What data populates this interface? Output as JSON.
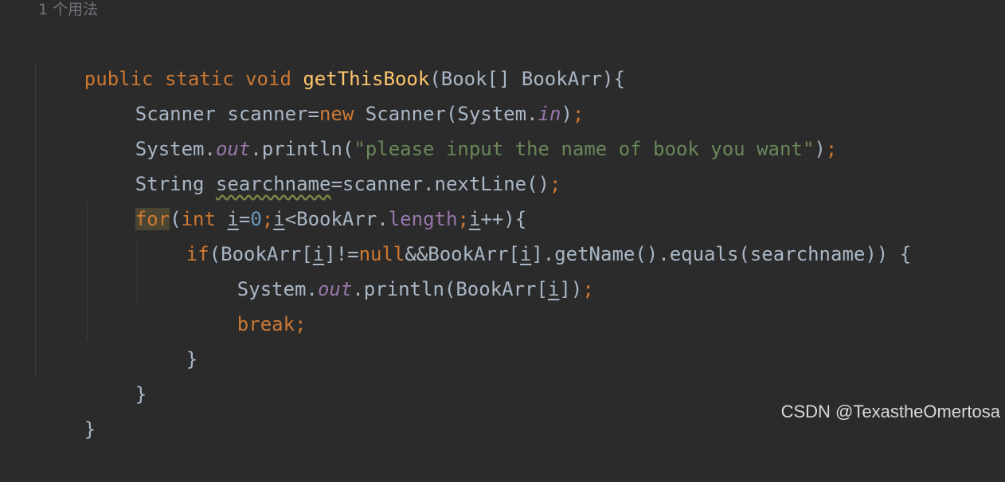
{
  "editor": {
    "usage_hint": "1 个用法",
    "tokens": {
      "public": "public",
      "static": "static",
      "void": "void",
      "method_name": "getThisBook",
      "sig_params": "(Book[] BookArr){",
      "scanner_decl": "Scanner scanner=",
      "new": "new",
      "scanner_ctor": " Scanner(System.",
      "in": "in",
      "close_paren": ")",
      "semi": ";",
      "system_dot": "System.",
      "out": "out",
      "println_open": ".println(",
      "prompt_string": "\"please input the name of book you want\"",
      "string_kw": "String ",
      "searchname": "searchname",
      "readline": "=scanner.nextLine()",
      "for": "for",
      "open_paren": "(",
      "int": "int",
      "space": " ",
      "i": "i",
      "eq": "=",
      "zero": "0",
      "lt_bookarr": "<BookArr.",
      "length": "length",
      "plusplus_brace": "++){",
      "if": "if",
      "bookarr_idx_open": "(BookArr[",
      "ne": "]!=",
      "null": "null",
      "and_bookarr": "&&BookArr[",
      "getname_equals": "].getName().equals(searchname)) {",
      "println_bookarr": ".println(BookArr[",
      "close_bracket_paren": "])",
      "break": "break",
      "close_brace": "}"
    }
  },
  "watermark": "CSDN @TexastheOmertosa",
  "colors": {
    "background": "#2b2b2b",
    "keyword": "#cc7832",
    "function": "#ffc66d",
    "text": "#a9b7c6",
    "string": "#6a8759",
    "number": "#6897bb",
    "field": "#9876aa"
  }
}
